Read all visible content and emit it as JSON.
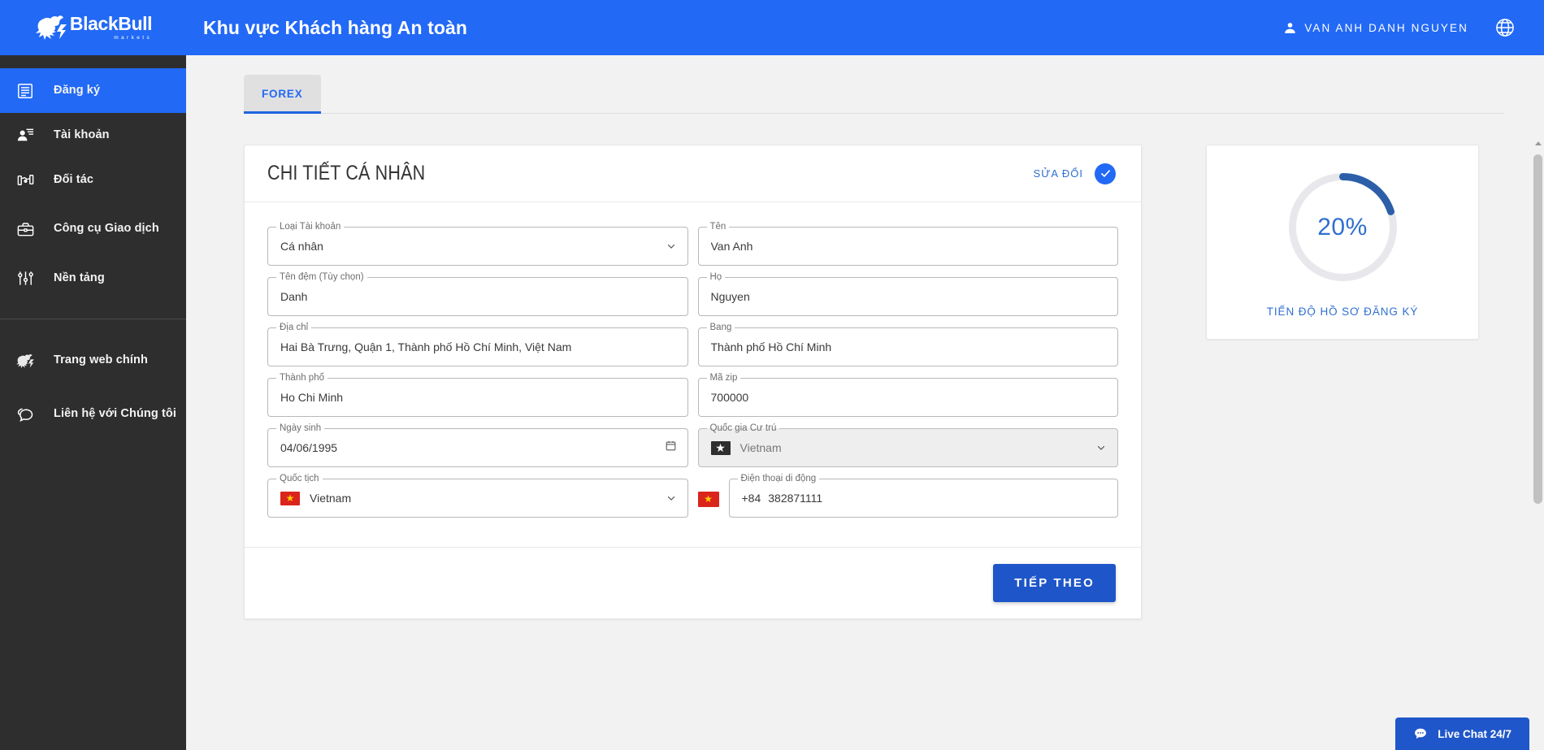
{
  "header": {
    "brand_name": "BlackBull",
    "brand_sub": "markets",
    "title": "Khu vực Khách hàng An toàn",
    "user_name": "VAN ANH DANH NGUYEN",
    "user_icon": "person-icon",
    "language_icon": "globe-icon",
    "background": "#2269f5"
  },
  "sidebar": {
    "background": "#2e2e2e",
    "active_background": "#2269f5",
    "items": [
      {
        "label": "Đăng ký",
        "icon": "register-form-icon",
        "active": true
      },
      {
        "label": "Tài khoản",
        "icon": "account-person-icon",
        "active": false
      },
      {
        "label": "Đối tác",
        "icon": "partners-handshake-icon",
        "active": false
      },
      {
        "label": "Công cụ Giao dịch",
        "icon": "briefcase-icon",
        "active": false
      },
      {
        "label": "Nền tảng",
        "icon": "sliders-icon",
        "active": false
      }
    ],
    "bottom_items": [
      {
        "label": "Trang web chính",
        "icon": "bull-logo-icon"
      },
      {
        "label": "Liên hệ với Chúng tôi",
        "icon": "chat-bubbles-icon"
      }
    ]
  },
  "tabs": [
    {
      "label": "FOREX",
      "active": true
    }
  ],
  "form_card": {
    "title": "CHI TIẾT CÁ NHÂN",
    "edit_label": "SỬA ĐỔI",
    "check_icon": "check-circle-icon",
    "submit_label": "TIẾP THEO",
    "fields": [
      {
        "label": "Loại Tài khoản",
        "value": "Cá nhân",
        "type": "select",
        "icon": "chevron-down-icon"
      },
      {
        "label": "Tên",
        "value": "Van Anh",
        "type": "text"
      },
      {
        "label": "Tên đệm (Tùy chọn)",
        "value": "Danh",
        "type": "text"
      },
      {
        "label": "Họ",
        "value": "Nguyen",
        "type": "text"
      },
      {
        "label": "Địa chỉ",
        "value": "Hai Bà Trưng, Quận 1, Thành phố Hồ Chí Minh, Việt Nam",
        "type": "text"
      },
      {
        "label": "Bang",
        "value": "Thành phố Hồ Chí Minh",
        "type": "text"
      },
      {
        "label": "Thành phố",
        "value": "Ho Chi Minh",
        "type": "text"
      },
      {
        "label": "Mã zip",
        "value": "700000",
        "type": "text"
      },
      {
        "label": "Ngày sinh",
        "value": "04/06/1995",
        "type": "date",
        "icon": "calendar-icon"
      },
      {
        "label": "Quốc gia Cư trú",
        "value": "Vietnam",
        "type": "select-disabled",
        "flag": "vietnam-flag-dark",
        "icon": "chevron-down-icon"
      },
      {
        "label": "Quốc tịch",
        "value": "Vietnam",
        "type": "select",
        "flag": "vietnam-flag",
        "icon": "chevron-down-icon"
      },
      {
        "label": "Điện thoại di động",
        "value": "382871111",
        "dial_code": "+84",
        "type": "phone",
        "flag": "vietnam-flag"
      }
    ]
  },
  "progress": {
    "percent_label": "20%",
    "percent_value": 20,
    "caption": "TIẾN ĐỘ HỒ SƠ ĐĂNG KÝ",
    "arc_color": "#2c5fa8",
    "track_color": "#e8e8ec",
    "text_color": "#2f6fd0"
  },
  "live_chat": {
    "label": "Live Chat 24/7",
    "icon": "chat-dots-icon",
    "background": "#1f56c9"
  }
}
